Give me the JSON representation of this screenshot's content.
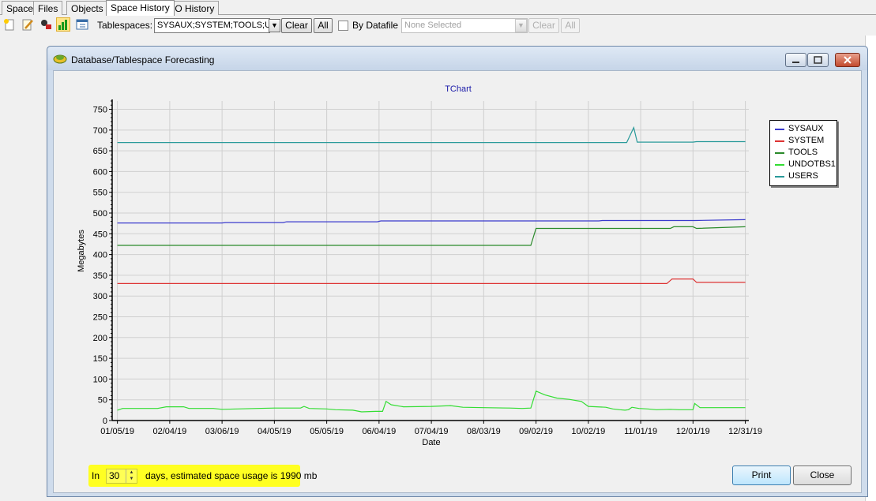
{
  "tabs": [
    "Space",
    "Files",
    "Objects",
    "Space History",
    "IO History"
  ],
  "active_tab": "Space History",
  "toolbar": {
    "tablespaces_label": "Tablespaces:",
    "tablespaces_value": "SYSAUX;SYSTEM;TOOLS;UNI",
    "clear_label": "Clear",
    "all_label": "All",
    "by_datafile_label": "By Datafile",
    "datafile_placeholder": "None Selected",
    "datafile_clear_label": "Clear",
    "datafile_all_label": "All",
    "icons": [
      "new-report-icon",
      "edit-icon",
      "tools-icon",
      "bar-chart-icon",
      "table-chart-icon"
    ]
  },
  "dialog": {
    "title": "Database/Tablespace Forecasting",
    "footer": {
      "prefix": "In",
      "days_value": "30",
      "suffix": "days, estimated space usage is 1990 mb"
    },
    "print_label": "Print",
    "close_label": "Close"
  },
  "chart_data": {
    "type": "line",
    "title": "TChart",
    "xlabel": "Date",
    "ylabel": "Megabytes",
    "ylim": [
      0,
      770
    ],
    "yticks": [
      0,
      50,
      100,
      150,
      200,
      250,
      300,
      350,
      400,
      450,
      500,
      550,
      600,
      650,
      700,
      750
    ],
    "x_tick_labels": [
      "01/05/19",
      "02/04/19",
      "03/06/19",
      "04/05/19",
      "05/05/19",
      "06/04/19",
      "07/04/19",
      "08/03/19",
      "09/02/19",
      "10/02/19",
      "11/01/19",
      "12/01/19",
      "12/31/19"
    ],
    "grid": true,
    "legend_position": "top-right",
    "series": [
      {
        "name": "SYSAUX",
        "color": "#3a3acd",
        "points": [
          [
            "01/05/19",
            476
          ],
          [
            "03/06/19",
            476
          ],
          [
            "03/08/19",
            477
          ],
          [
            "04/10/19",
            477
          ],
          [
            "04/12/19",
            479
          ],
          [
            "06/03/19",
            479
          ],
          [
            "06/05/19",
            481
          ],
          [
            "10/08/19",
            481
          ],
          [
            "10/10/19",
            482
          ],
          [
            "12/02/19",
            482
          ],
          [
            "12/31/19",
            484
          ]
        ]
      },
      {
        "name": "SYSTEM",
        "color": "#dd3333",
        "points": [
          [
            "01/05/19",
            330
          ],
          [
            "11/16/19",
            330
          ],
          [
            "11/19/19",
            341
          ],
          [
            "12/01/19",
            341
          ],
          [
            "12/03/19",
            333
          ],
          [
            "12/31/19",
            333
          ]
        ]
      },
      {
        "name": "TOOLS",
        "color": "#2a8a2a",
        "points": [
          [
            "01/05/19",
            422
          ],
          [
            "08/30/19",
            422
          ],
          [
            "09/02/19",
            463
          ],
          [
            "11/18/19",
            463
          ],
          [
            "11/20/19",
            467
          ],
          [
            "12/01/19",
            467
          ],
          [
            "12/03/19",
            463
          ],
          [
            "12/31/19",
            467
          ]
        ]
      },
      {
        "name": "UNDOTBS1",
        "color": "#33dd33",
        "points": [
          [
            "01/05/19",
            25
          ],
          [
            "01/08/19",
            29
          ],
          [
            "01/20/19",
            29
          ],
          [
            "01/28/19",
            29
          ],
          [
            "02/02/19",
            33
          ],
          [
            "02/12/19",
            33
          ],
          [
            "02/15/19",
            29
          ],
          [
            "03/01/19",
            29
          ],
          [
            "03/06/19",
            27
          ],
          [
            "03/26/19",
            29
          ],
          [
            "04/05/19",
            30
          ],
          [
            "04/20/19",
            30
          ],
          [
            "04/22/19",
            34
          ],
          [
            "04/25/19",
            29
          ],
          [
            "05/05/19",
            28
          ],
          [
            "05/10/19",
            26
          ],
          [
            "05/20/19",
            25
          ],
          [
            "05/25/19",
            21
          ],
          [
            "06/02/19",
            22
          ],
          [
            "06/06/19",
            22
          ],
          [
            "06/08/19",
            46
          ],
          [
            "06/11/19",
            38
          ],
          [
            "06/18/19",
            33
          ],
          [
            "07/04/19",
            34
          ],
          [
            "07/15/19",
            36
          ],
          [
            "07/22/19",
            32
          ],
          [
            "08/03/19",
            31
          ],
          [
            "08/18/19",
            30
          ],
          [
            "08/25/19",
            29
          ],
          [
            "08/30/19",
            30
          ],
          [
            "09/02/19",
            71
          ],
          [
            "09/07/19",
            62
          ],
          [
            "09/14/19",
            54
          ],
          [
            "09/21/19",
            51
          ],
          [
            "09/28/19",
            46
          ],
          [
            "10/02/19",
            34
          ],
          [
            "10/12/19",
            32
          ],
          [
            "10/16/19",
            28
          ],
          [
            "10/20/19",
            26
          ],
          [
            "10/23/19",
            25
          ],
          [
            "10/25/19",
            26
          ],
          [
            "10/27/19",
            32
          ],
          [
            "10/31/19",
            29
          ],
          [
            "11/05/19",
            28
          ],
          [
            "11/10/19",
            26
          ],
          [
            "11/18/19",
            27
          ],
          [
            "11/23/19",
            26
          ],
          [
            "12/01/19",
            26
          ],
          [
            "12/02/19",
            41
          ],
          [
            "12/05/19",
            31
          ],
          [
            "12/31/19",
            31
          ]
        ]
      },
      {
        "name": "USERS",
        "color": "#2a9a9a",
        "points": [
          [
            "01/05/19",
            670
          ],
          [
            "10/24/19",
            670
          ],
          [
            "10/28/19",
            706
          ],
          [
            "10/30/19",
            671
          ],
          [
            "12/01/19",
            671
          ],
          [
            "12/03/19",
            672
          ],
          [
            "12/31/19",
            672
          ]
        ]
      }
    ]
  }
}
